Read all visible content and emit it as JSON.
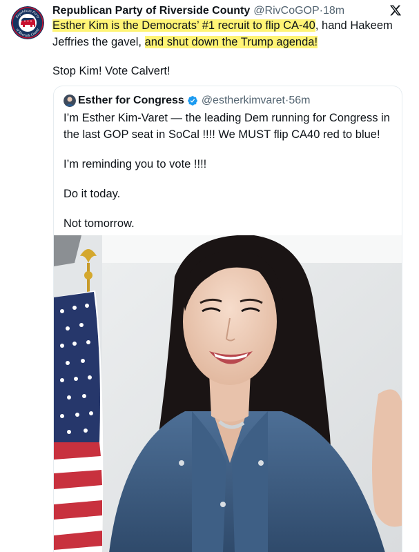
{
  "post": {
    "author_name": "Republican Party of Riverside County",
    "handle": "@RivCoGOP",
    "separator": "·",
    "time": "18m",
    "avatar_icon": "republican-party-riverside-county-seal",
    "avatar_seal_top_text": "Republican Party",
    "avatar_seal_bottom_text": "of Riverside County",
    "platform_icon": "x-logo-icon",
    "text_line1_hl": "Esther Kim is the Democrats’ #1 recruit to flip CA-40",
    "text_line1_rest": ", hand Hakeem Jeffries the gavel, ",
    "text_line2_hl": "and shut down the Trump agenda!",
    "text_para2": "Stop Kim! Vote Calvert!",
    "highlight_color": "#fff475"
  },
  "quoted_post": {
    "author_name": "Esther for Congress",
    "verified_icon": "verified-badge-icon",
    "handle": "@estherkimvaret",
    "separator": "·",
    "time": "56m",
    "paragraphs": [
      "I’m Esther Kim-Varet — the leading Dem running for Congress in the last GOP seat in SoCal !!!! We MUST flip CA40 red to blue!",
      "I’m reminding you to vote !!!!",
      "Do it today.",
      "Not tomorrow."
    ],
    "media": {
      "type": "video-thumbnail",
      "description_icon": "video-still-woman-with-american-flag"
    }
  },
  "colors": {
    "text": "#0f1419",
    "secondary": "#536471",
    "verified": "#1d9bf0",
    "border": "#e6ecf0"
  }
}
